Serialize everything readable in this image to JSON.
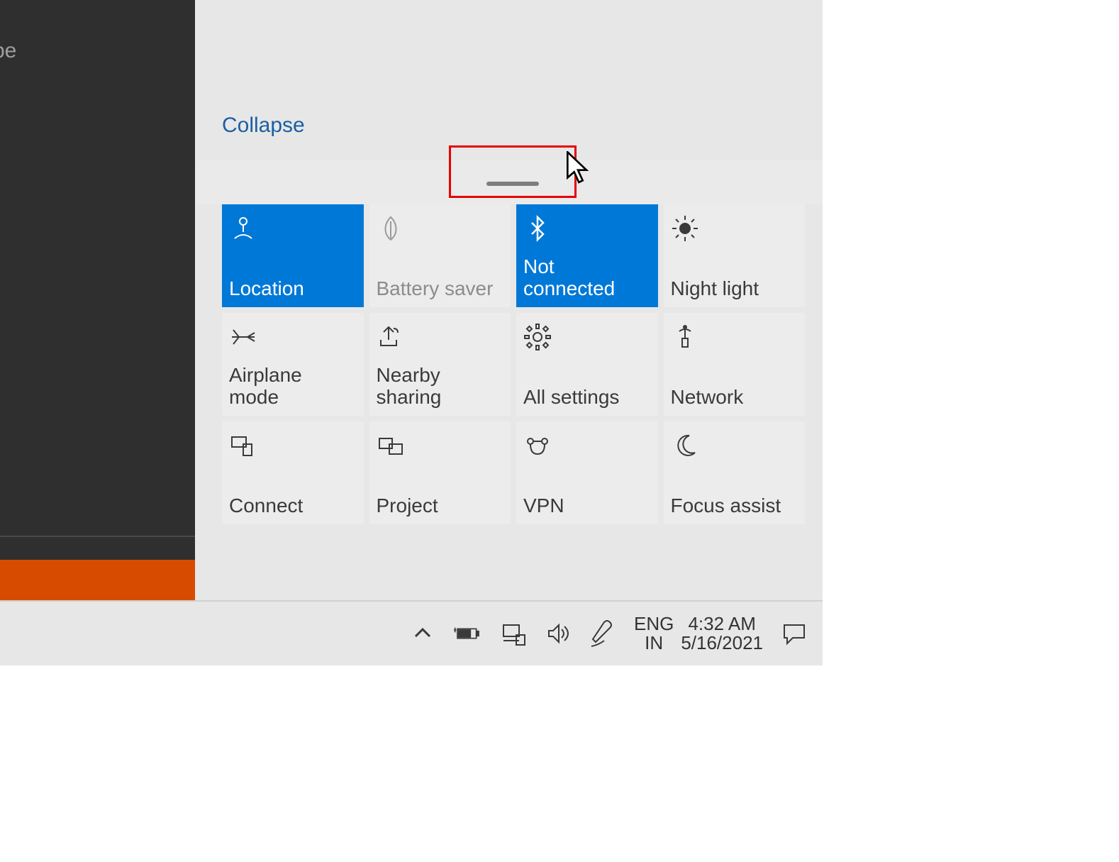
{
  "left_panel": {
    "partial_label": "pe"
  },
  "action_center": {
    "collapse_label": "Collapse",
    "tiles": {
      "location": "Location",
      "battery_saver": "Battery saver",
      "bluetooth": "Not connected",
      "night_light": "Night light",
      "airplane_mode": "Airplane mode",
      "nearby_sharing": "Nearby sharing",
      "all_settings": "All settings",
      "network": "Network",
      "connect": "Connect",
      "project": "Project",
      "vpn": "VPN",
      "focus_assist": "Focus assist"
    }
  },
  "taskbar": {
    "lang_top": "ENG",
    "lang_bottom": "IN",
    "time": "4:32 AM",
    "date": "5/16/2021"
  }
}
